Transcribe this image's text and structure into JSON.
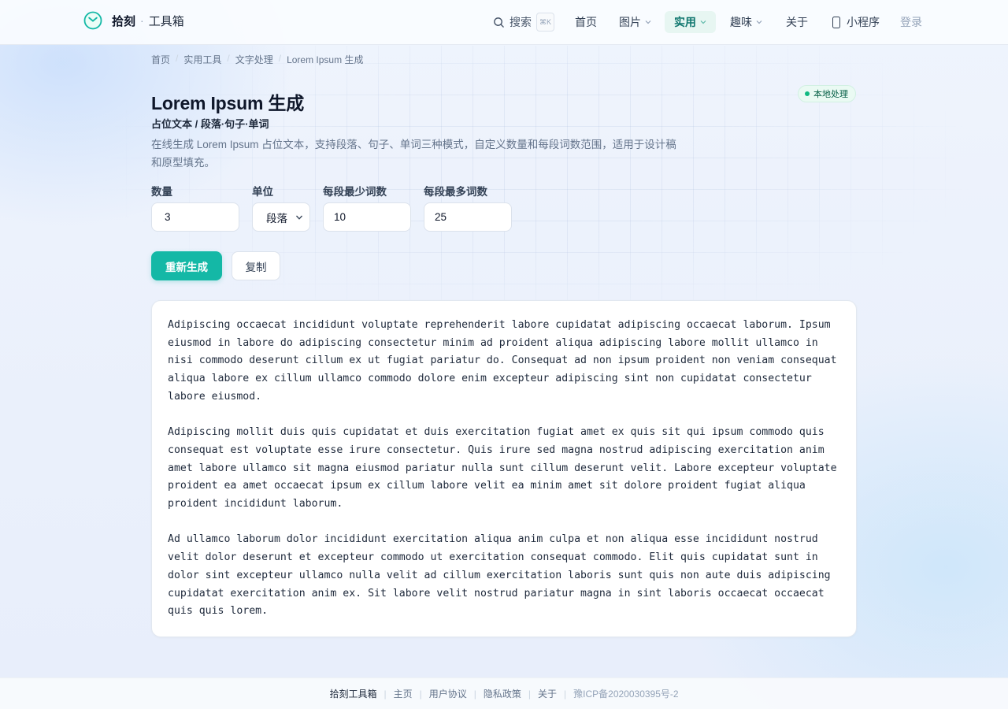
{
  "header": {
    "brand_name": "拾刻",
    "brand_sub": "工具箱",
    "search_label": "搜索",
    "search_shortcut": "⌘K",
    "nav": {
      "home": "首页",
      "images": "图片",
      "practical": "实用",
      "fun": "趣味",
      "about": "关于",
      "miniprogram": "小程序",
      "login": "登录"
    },
    "accent_color": "#14b8a6"
  },
  "breadcrumb": [
    "首页",
    "实用工具",
    "文字处理",
    "Lorem Ipsum 生成"
  ],
  "page": {
    "title": "Lorem Ipsum 生成",
    "subtitle": "占位文本 / 段落·句子·单词",
    "description": "在线生成 Lorem Ipsum 占位文本，支持段落、句子、单词三种模式，自定义数量和每段词数范围，适用于设计稿和原型填充。",
    "badge": "本地处理"
  },
  "form": {
    "count_label": "数量",
    "count_value": "3",
    "unit_label": "单位",
    "unit_value": "段落",
    "min_label": "每段最少词数",
    "min_value": "10",
    "max_label": "每段最多词数",
    "max_value": "25"
  },
  "actions": {
    "regenerate": "重新生成",
    "copy": "复制"
  },
  "output": {
    "paragraphs": [
      "Adipiscing occaecat incididunt voluptate reprehenderit labore cupidatat adipiscing occaecat laborum. Ipsum eiusmod in labore do adipiscing consectetur minim ad proident aliqua adipiscing labore mollit ullamco in nisi commodo deserunt cillum ex ut fugiat pariatur do. Consequat ad non ipsum proident non veniam consequat aliqua labore ex cillum ullamco commodo dolore enim excepteur adipiscing sint non cupidatat consectetur labore eiusmod.",
      "Adipiscing mollit duis quis cupidatat et duis exercitation fugiat amet ex quis sit qui ipsum commodo quis consequat est voluptate esse irure consectetur. Quis irure sed magna nostrud adipiscing exercitation anim amet labore ullamco sit magna eiusmod pariatur nulla sunt cillum deserunt velit. Labore excepteur voluptate proident ea amet occaecat ipsum ex cillum labore velit ea minim amet sit dolore proident fugiat aliqua proident incididunt laborum.",
      "Ad ullamco laborum dolor incididunt exercitation aliqua anim culpa et non aliqua esse incididunt nostrud velit dolor deserunt et excepteur commodo ut exercitation consequat commodo. Elit quis cupidatat sunt in dolor sint excepteur ullamco nulla velit ad cillum exercitation laboris sunt quis non aute duis adipiscing cupidatat exercitation anim ex. Sit labore velit nostrud pariatur magna in sint laboris occaecat occaecat quis quis lorem."
    ]
  },
  "footer": {
    "brand": "拾刻工具箱",
    "home": "主页",
    "terms": "用户协议",
    "privacy": "隐私政策",
    "about": "关于",
    "icp": "豫ICP备2020030395号-2"
  }
}
